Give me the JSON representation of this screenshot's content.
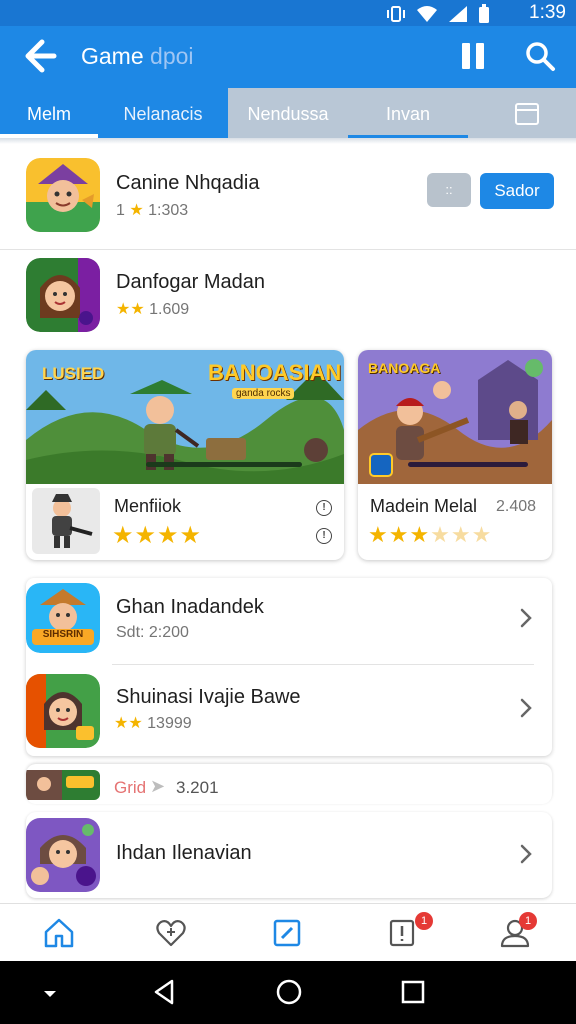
{
  "status_bar": {
    "time": "1:39"
  },
  "app_bar": {
    "title_main": "Game",
    "title_dim": "dpoi"
  },
  "tabs": [
    {
      "label": "Melm"
    },
    {
      "label": "Nelanacis"
    },
    {
      "label": "Nendussa"
    },
    {
      "label": "Invan"
    }
  ],
  "featured": {
    "title": "Canine Nhqadia",
    "rating_prefix": "1",
    "rating": "1:303",
    "secondary_button": "::",
    "primary_button": "Sador"
  },
  "item_2": {
    "title": "Danfogar Madan",
    "rating": "1.609"
  },
  "banner_cards": [
    {
      "banner_left_text": "LUSIED",
      "banner_right_text": "BANOASIAN",
      "banner_sub": "ganda rocks",
      "title": "Menfiiok"
    },
    {
      "banner_text": "BANOAGA",
      "title": "Madein Melal",
      "count": "2.408"
    }
  ],
  "list": [
    {
      "title": "Ghan Inadandek",
      "sub": "Sdt: 2:200",
      "icon_text": "SIHSRIN"
    },
    {
      "title": "Shuinasi Ivajie Bawe",
      "rating": "13999"
    }
  ],
  "partial_row": {
    "label": "Grid",
    "value": "3.201"
  },
  "last_item": {
    "title": "Ihdan Ilenavian"
  },
  "bottom_nav": {
    "badge_1": "1",
    "badge_2": "1"
  },
  "colors": {
    "primary": "#1e88e5",
    "status": "#1976d2",
    "star": "#f4b400",
    "badge": "#e53935"
  }
}
